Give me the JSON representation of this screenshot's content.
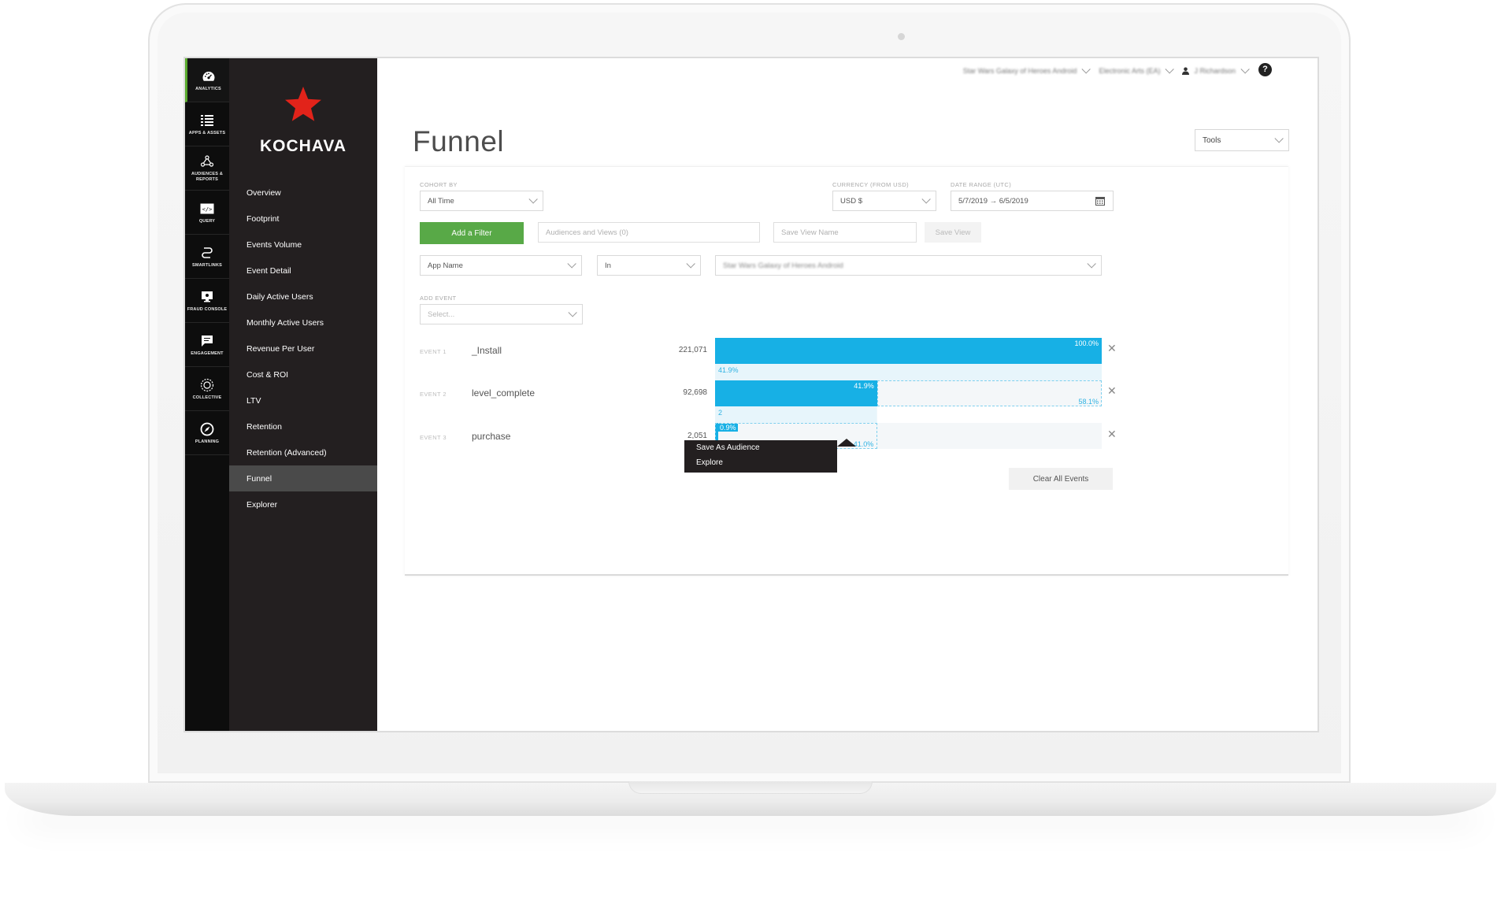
{
  "rail": {
    "items": [
      {
        "label": "ANALYTICS",
        "icon": "dashboard-gauge-icon"
      },
      {
        "label": "APPS & ASSETS",
        "icon": "list-icon"
      },
      {
        "label": "AUDIENCES & REPORTS",
        "icon": "people-network-icon"
      },
      {
        "label": "QUERY",
        "icon": "code-window-icon"
      },
      {
        "label": "SMARTLINKS",
        "icon": "link-path-icon"
      },
      {
        "label": "FRAUD CONSOLE",
        "icon": "monitor-icon"
      },
      {
        "label": "ENGAGEMENT",
        "icon": "chat-bubble-icon"
      },
      {
        "label": "COLLECTIVE",
        "icon": "collective-circle-icon"
      },
      {
        "label": "PLANNING",
        "icon": "compass-icon"
      }
    ]
  },
  "brand": {
    "name": "KOCHAVA",
    "star_color": "#e2231a"
  },
  "nav": {
    "items": [
      "Overview",
      "Footprint",
      "Events Volume",
      "Event Detail",
      "Daily Active Users",
      "Monthly Active Users",
      "Revenue Per User",
      "Cost & ROI",
      "LTV",
      "Retention",
      "Retention (Advanced)",
      "Funnel",
      "Explorer"
    ],
    "active": "Funnel"
  },
  "topbar": {
    "app": "Star Wars Galaxy of Heroes Android",
    "account": "Electronic Arts (EA)",
    "user": "J Richardson",
    "help": "?"
  },
  "page": {
    "title": "Funnel",
    "tools_label": "Tools"
  },
  "filters": {
    "cohort_label": "COHORT BY",
    "cohort_value": "All Time",
    "currency_label": "CURRENCY (FROM USD)",
    "currency_value": "USD $",
    "date_label": "DATE RANGE (UTC)",
    "date_value": "5/7/2019 → 6/5/2019",
    "add_filter": "Add a Filter",
    "audiences_placeholder": "Audiences and Views (0)",
    "save_view_placeholder": "Save View Name",
    "save_view": "Save View",
    "field_value": "App Name",
    "operator_value": "In",
    "app_chip": "Star Wars Galaxy of Heroes Android",
    "add_event_label": "ADD EVENT",
    "add_event_placeholder": "Select..."
  },
  "funnel": {
    "events": [
      {
        "num": "EVENT 1",
        "name": "_Install",
        "count": "221,071",
        "pct": "100.0%",
        "fraction": 1.0
      },
      {
        "num": "EVENT 2",
        "name": "level_complete",
        "count": "92,698",
        "pct": "41.9%",
        "fraction": 0.419,
        "drop": "58.1%"
      },
      {
        "num": "EVENT 3",
        "name": "purchase",
        "count": "2,051",
        "pct": "0.9%",
        "fraction": 0.009,
        "drop": "41.0%"
      }
    ],
    "conversion_1": "41.9%",
    "conversion_2": "2",
    "clear_all": "Clear All Events",
    "bar_color": "#17b0e5"
  },
  "context_menu": {
    "items": [
      "Save As Audience",
      "Explore"
    ]
  }
}
